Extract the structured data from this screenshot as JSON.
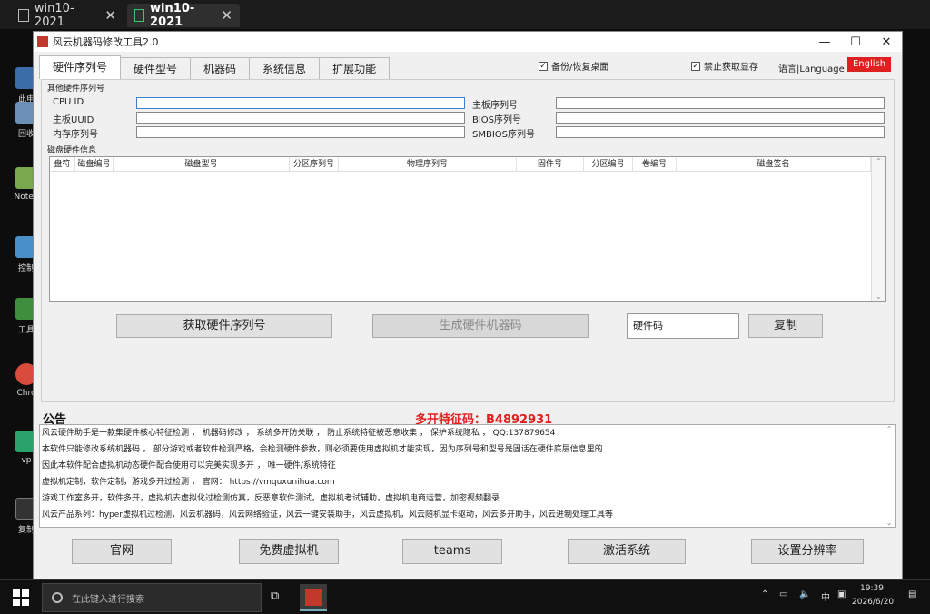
{
  "vm_tabs": [
    {
      "label": "win10-2021"
    },
    {
      "label": "win10-2021"
    }
  ],
  "desktop_icons": [
    "此电",
    "回收",
    "Notep",
    "控制",
    "工具",
    "Chro",
    "vp",
    "复制"
  ],
  "window": {
    "title": "风云机器码修改工具2.0",
    "tabs": [
      "硬件序列号",
      "硬件型号",
      "机器码",
      "系统信息",
      "扩展功能"
    ],
    "backup_label": "备份/恢复桌面",
    "forbid_label": "禁止获取显存",
    "language_label": "语言|Language",
    "english_label": "English"
  },
  "other_hw": {
    "group_label": "其他硬件序列号",
    "cpu_id": "CPU ID",
    "board_serial": "主板序列号",
    "board_uuid": "主板UUID",
    "bios_serial": "BIOS序列号",
    "mem_serial": "内存序列号",
    "smbios_serial": "SMBIOS序列号"
  },
  "disk": {
    "group_label": "磁盘硬件信息",
    "columns": [
      "盘符",
      "磁盘编号",
      "磁盘型号",
      "分区序列号",
      "物理序列号",
      "固件号",
      "分区编号",
      "卷编号",
      "磁盘签名"
    ]
  },
  "actions": {
    "get_serial": "获取硬件序列号",
    "generate": "生成硬件机器码",
    "hw_code": "硬件码",
    "copy": "复制"
  },
  "announcement": {
    "title": "公告",
    "feature_code": "多开特征码：B4892931",
    "lines": [
      "风云硬件助手是一款集硬件核心特征检测 ， 机器码修改 ， 系统多开防关联 ， 防止系统特征被恶意收集 ， 保护系统隐私 ，  QQ:137879654",
      "本软件只能修改系统机器码 ， 部分游戏或者软件检测严格，会检测硬件参数，则必须要使用虚拟机才能实现，因为序列号和型号是固话在硬件底层信息里的",
      "因此本软件配合虚拟机动态硬件配合使用可以完美实现多开 ， 唯一硬件/系统特征",
      "虚拟机定制，软件定制，游戏多开过检测 ， 官网： https://vmquxunihua.com",
      "游戏工作室多开，软件多开，虚拟机去虚拟化过检测仿真，反恶意软件测试，虚拟机考试辅助，虚拟机电商运营，加密视频翻录",
      "风云产品系列：hyper虚拟机过检测，风云机器码，风云网络验证，风云一键安装助手，风云虚拟机，风云随机显卡驱动，风云多开助手，风云进制处理工具等"
    ]
  },
  "bottom_buttons": [
    "官网",
    "免费虚拟机",
    "teams",
    "激活系统",
    "设置分辨率"
  ],
  "taskbar": {
    "search_placeholder": "在此键入进行搜索",
    "ime": "中",
    "time": "19:39",
    "date": "2026/6/20"
  }
}
